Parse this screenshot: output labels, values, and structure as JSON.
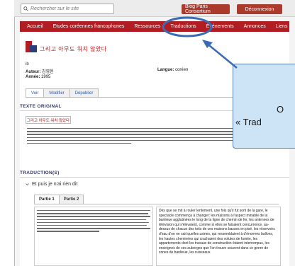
{
  "search": {
    "placeholder": "Rechercher sur le site"
  },
  "topbar": {
    "consortium": "Blog Paris Consortium",
    "logout": "Déconnexion"
  },
  "nav": [
    {
      "label": "Accueil"
    },
    {
      "label": "Etudes coréennes francophones"
    },
    {
      "label": "Ressources"
    },
    {
      "label": "Traductions"
    },
    {
      "label": "Événements"
    },
    {
      "label": "Annonces"
    },
    {
      "label": "Liens"
    }
  ],
  "page": {
    "title": "그리고 아무도 워치 않았다",
    "mark": "ib"
  },
  "meta": {
    "author_label": "Auteur:",
    "author_value": "김영현",
    "year_label": "Année:",
    "year_value": "1995",
    "lang_label": "Langue:",
    "lang_value": "coréen"
  },
  "tabs": {
    "view": "Voir",
    "edit": "Modifier",
    "unpublish": "Dépublier"
  },
  "sections": {
    "original": "TEXTE ORIGINAL",
    "translations": "TRADUCTION(S)"
  },
  "original_box": "그리고 아무도 워치 않았다",
  "translation_item": "Et puis je n'ai rien dit",
  "part_tabs": {
    "p1": "Partie 1",
    "p2": "Partie 2"
  },
  "translation_text": "Dès que se mit à rouler lentement, une fois qu'il fut sorti de la gare, le spectacle commença à changer: les maisons à l'aspect minable de la banlieue agglutinées le long de la ligne de chemin de fer, les antennes de télévision qui s'élevaient, comme si elles se faisaient concurrence, au-dessus de chacun des toits de ces maisons basses en pisé, les réservoirs d'eau d'on ne sait quelles usines, qui ressemblaient à d'énormes ballons, les hautes cheminées qui crachaient des volutes de fumée, les appartements dont les travaux de construction étaient interrompus, les enseignes de ces auberges que l'on trouve souvent dans ce genre de zones de banlieue, les ruisseaux",
  "callout": {
    "line1": "O",
    "line2": "« Trad"
  },
  "colors": {
    "brand": "#b01e23",
    "accent": "#2f5aa8",
    "callout_bg": "#cde4f7",
    "annotation": "#3a6bb5"
  }
}
